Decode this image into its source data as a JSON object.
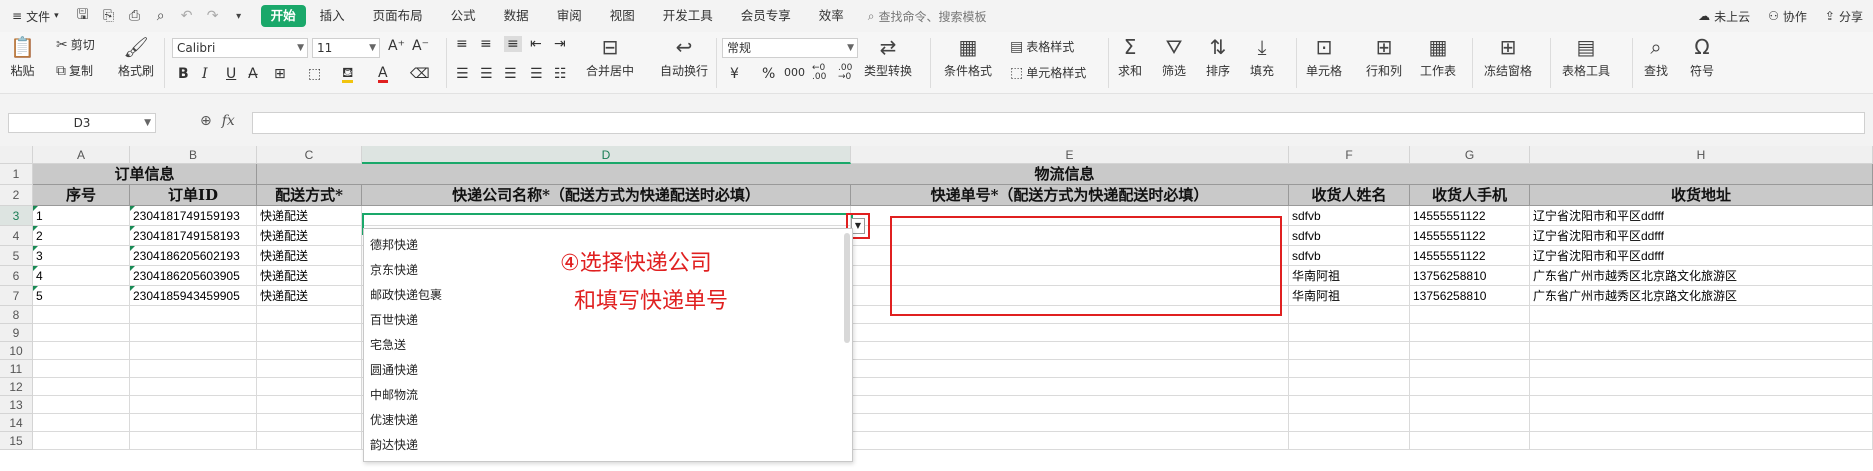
{
  "menubar": {
    "file": "文件",
    "tabs": [
      "开始",
      "插入",
      "页面布局",
      "公式",
      "数据",
      "审阅",
      "视图",
      "开发工具",
      "会员专享",
      "效率"
    ],
    "search": "查找命令、搜索模板",
    "right": [
      "未上云",
      "协作",
      "分享"
    ]
  },
  "ribbon": {
    "paste": "粘贴",
    "cut": "剪切",
    "copy": "复制",
    "format_painter": "格式刷",
    "font_name": "Calibri",
    "font_size": "11",
    "merge_center": "合并居中",
    "wrap_text": "自动换行",
    "number_format": "常规",
    "type_convert": "类型转换",
    "conditional_format": "条件格式",
    "table_style": "表格样式",
    "cell_style": "单元格样式",
    "sum": "求和",
    "filter": "筛选",
    "sort": "排序",
    "fill": "填充",
    "cell": "单元格",
    "rows_cols": "行和列",
    "worksheet": "工作表",
    "freeze": "冻结窗格",
    "table_tools": "表格工具",
    "find": "查找",
    "symbol": "符号"
  },
  "formula_bar": {
    "name_box": "D3",
    "fx": "fx",
    "value": ""
  },
  "sheet": {
    "columns": [
      "A",
      "B",
      "C",
      "D",
      "E",
      "F",
      "G",
      "H"
    ],
    "rows": [
      "1",
      "2",
      "3",
      "4",
      "5",
      "6",
      "7",
      "8",
      "9",
      "10",
      "11",
      "12",
      "13",
      "14",
      "15"
    ],
    "group_headers": {
      "order_info": "订单信息",
      "logistics_info": "物流信息"
    },
    "headers": [
      "序号",
      "订单ID",
      "配送方式*",
      "快递公司名称*（配送方式为快递配送时必填）",
      "快递单号*（配送方式为快递配送时必填）",
      "收货人姓名",
      "收货人手机",
      "收货地址"
    ],
    "data": [
      [
        "1",
        "2304181749159193",
        "快递配送",
        "",
        "",
        "sdfvb",
        "14555551122",
        "辽宁省沈阳市和平区ddfff"
      ],
      [
        "2",
        "2304181749158193",
        "快递配送",
        "",
        "",
        "sdfvb",
        "14555551122",
        "辽宁省沈阳市和平区ddfff"
      ],
      [
        "3",
        "2304186205602193",
        "快递配送",
        "",
        "",
        "sdfvb",
        "14555551122",
        "辽宁省沈阳市和平区ddfff"
      ],
      [
        "4",
        "2304186205603905",
        "快递配送",
        "",
        "",
        "华南阿祖",
        "13756258810",
        "广东省广州市越秀区北京路文化旅游区"
      ],
      [
        "5",
        "2304185943459905",
        "快递配送",
        "",
        "",
        "华南阿祖",
        "13756258810",
        "广东省广州市越秀区北京路文化旅游区"
      ]
    ]
  },
  "dropdown": {
    "items": [
      "德邦快递",
      "京东快递",
      "邮政快递包裹",
      "百世快递",
      "宅急送",
      "圆通快递",
      "中邮物流",
      "优速快递",
      "韵达快递"
    ]
  },
  "annotation": {
    "line1": "④选择快递公司",
    "line2": "和填写快递单号"
  },
  "colors": {
    "accent": "#1aa86a",
    "annotation": "#e02020",
    "header_fill": "#c9c9c9"
  }
}
